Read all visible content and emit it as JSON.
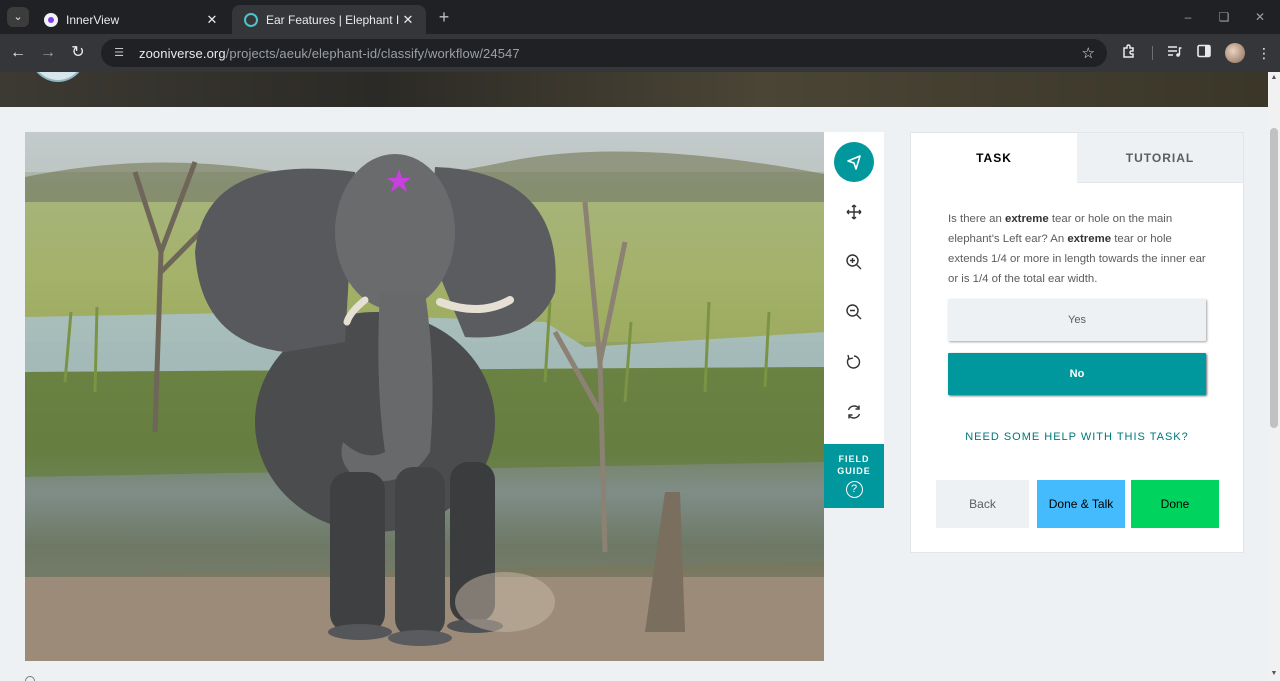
{
  "browser": {
    "tabs": [
      {
        "title": "InnerView",
        "active": false
      },
      {
        "title": "Ear Features | Elephant ID | Zoo",
        "active": true
      }
    ],
    "url_host": "zooniverse.org",
    "url_path": "/projects/aeuk/elephant-id/classify/workflow/24547",
    "icons": {
      "tab_search": "chevron-down-icon",
      "tab_close": "close-icon",
      "new_tab": "plus-icon",
      "back": "arrow-left-icon",
      "forward": "arrow-right-icon",
      "reload": "reload-icon",
      "site_info": "tune-icon",
      "bookmark": "star-icon",
      "extensions": "puzzle-icon",
      "media": "playlist-icon",
      "side_panel": "side-panel-icon",
      "menu": "kebab-menu-icon"
    }
  },
  "subject": {
    "alt_name": "elephant-photo",
    "marker_color": "#c840e0"
  },
  "tools": [
    {
      "name": "pointer",
      "icon": "pointer-arrow-icon",
      "active": true
    },
    {
      "name": "move",
      "icon": "move-arrows-icon",
      "active": false
    },
    {
      "name": "zoom-in",
      "icon": "zoom-in-icon",
      "active": false
    },
    {
      "name": "zoom-out",
      "icon": "zoom-out-icon",
      "active": false
    },
    {
      "name": "rotate",
      "icon": "rotate-icon",
      "active": false
    },
    {
      "name": "reset",
      "icon": "reset-icon",
      "active": false
    }
  ],
  "field_guide": {
    "line1": "FIELD",
    "line2": "GUIDE",
    "icon_glyph": "?"
  },
  "panel": {
    "tab_task": "TASK",
    "tab_tutorial": "TUTORIAL",
    "question": {
      "p1": "Is there an ",
      "b1": "extreme",
      "p2": " tear or hole on the main elephant's Left ear? An ",
      "b2": "extreme",
      "p3": " tear or hole extends 1/4 or more in length towards the inner ear or is 1/4 of the total ear width."
    },
    "answers": [
      {
        "label": "Yes",
        "selected": false
      },
      {
        "label": "No",
        "selected": true
      }
    ],
    "help_link": "NEED SOME HELP WITH THIS TASK?",
    "back_label": "Back",
    "done_talk_label": "Done & Talk",
    "done_label": "Done"
  },
  "colors": {
    "teal": "#00979d",
    "done_green": "#00d45e",
    "talk_blue": "#43bbfd",
    "panel_bg": "#eef1f4"
  }
}
